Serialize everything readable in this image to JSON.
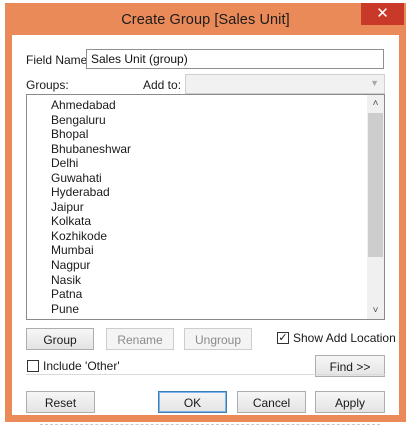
{
  "window": {
    "title": "Create Group [Sales Unit]",
    "close_glyph": "✕"
  },
  "field_name": {
    "label": "Field Name:",
    "value": "Sales Unit (group)"
  },
  "groups_label": "Groups:",
  "add_to": {
    "label": "Add to:",
    "value": ""
  },
  "list": {
    "items": [
      "Ahmedabad",
      "Bengaluru",
      "Bhopal",
      "Bhubaneshwar",
      "Delhi",
      "Guwahati",
      "Hyderabad",
      "Jaipur",
      "Kolkata",
      "Kozhikode",
      "Mumbai",
      "Nagpur",
      "Nasik",
      "Patna",
      "Pune"
    ],
    "scroll_up_glyph": "˄",
    "scroll_down_glyph": "˅"
  },
  "buttons": {
    "group": "Group",
    "rename": "Rename",
    "ungroup": "Ungroup",
    "find": "Find >>",
    "reset": "Reset",
    "ok": "OK",
    "cancel": "Cancel",
    "apply": "Apply"
  },
  "show_add_location": {
    "label": "Show Add Location",
    "checked": true,
    "check_glyph": "✓"
  },
  "include_other": {
    "label": "Include 'Other'",
    "checked": false
  },
  "colors": {
    "title_bar": "#ea8a59",
    "close_button": "#c9392a"
  },
  "icons": {
    "close": "close-icon",
    "scroll_up": "chevron-up-icon",
    "scroll_down": "chevron-down-icon",
    "dropdown": "chevron-down-icon",
    "check": "check-icon"
  }
}
